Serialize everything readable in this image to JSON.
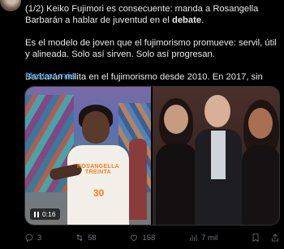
{
  "tweet": {
    "line1_prefix": "(1/2) Keiko Fujimori es consecuente: manda a Rosangella Barbarán a hablar de juventud en el ",
    "line1_bold": "debate",
    "line1_suffix": ".",
    "para2": "Es el modelo de joven que el fujimorismo promueve: servil, útil y alineada. Solo así sirven. Solo así progresan.",
    "para3": "Barbarán milita en el fujimorismo desde 2010. En 2017, sin",
    "show_more": "Mostrar más"
  },
  "media": {
    "shirt_text": "ROSANGELLA TREINTA",
    "shirt_number": "30",
    "video_time": "0:16"
  },
  "actions": {
    "replies": "3",
    "reposts": "58",
    "likes": "158",
    "views": "7 mil"
  }
}
